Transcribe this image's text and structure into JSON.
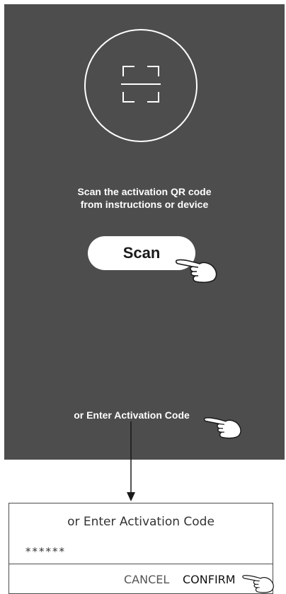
{
  "scan_screen": {
    "instruction_line1": "Scan the activation QR code",
    "instruction_line2": "from instructions or device",
    "scan_button": "Scan",
    "enter_code_link": "or Enter Activation Code"
  },
  "dialog": {
    "title": "or Enter Activation Code",
    "code_value": "******",
    "cancel_label": "CANCEL",
    "confirm_label": "CONFIRM"
  },
  "colors": {
    "screen_background": "#4d4d4d",
    "text_on_dark": "#ffffff",
    "button_background": "#ffffff"
  },
  "icons": [
    "qr-scan-icon",
    "pointing-hand-icon",
    "down-arrow-icon"
  ]
}
